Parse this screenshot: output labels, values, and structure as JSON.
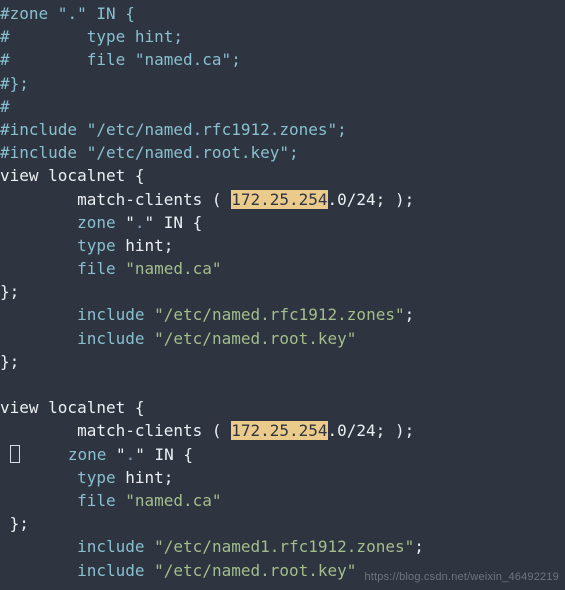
{
  "lines": {
    "l1_a": "#zone \"",
    "l1_b": ".",
    "l1_c": "\" IN {",
    "l2": "#        type hint;",
    "l3": "#        file \"named.ca\";",
    "l4": "#};",
    "l5": "#",
    "l6_a": "#include ",
    "l6_b": "\"/etc/named.rfc1912.zones\"",
    "l6_c": ";",
    "l7_a": "#include ",
    "l7_b": "\"/etc/named.root.key\"",
    "l7_c": ";",
    "l8": "view localnet {",
    "l9_a": "        match-clients ( ",
    "l9_hl": "172.25.254",
    "l9_b": ".0/24; );",
    "l10_a": "        ",
    "l10_b": "zone",
    "l10_c": " \"",
    "l10_d": ".",
    "l10_e": "\" IN {",
    "l11_a": "        ",
    "l11_b": "type",
    "l11_c": " hint",
    "l11_d": ";",
    "l12_a": "        ",
    "l12_b": "file",
    "l12_c": " ",
    "l12_d": "\"named.ca\"",
    "l13": "};",
    "l14_a": "        ",
    "l14_b": "include",
    "l14_c": " ",
    "l14_d": "\"/etc/named.rfc1912.zones\"",
    "l14_e": ";",
    "l15_a": "        ",
    "l15_b": "include",
    "l15_c": " ",
    "l15_d": "\"/etc/named.root.key\"",
    "l16": "};",
    "blank": "",
    "l17": "view localnet {",
    "l18_a": "        match-clients ( ",
    "l18_hl": "172.25.254",
    "l18_b": ".0/24; );",
    "l19_a": "        ",
    "l19_b": "zone",
    "l19_c": " \"",
    "l19_d": ".",
    "l19_e": "\" IN {",
    "l20_a": "        ",
    "l20_b": "type",
    "l20_c": " hint",
    "l20_d": ";",
    "l21_a": "        ",
    "l21_b": "file",
    "l21_c": " ",
    "l21_d": "\"named.ca\"",
    "l22": " };",
    "l23_a": "        ",
    "l23_b": "include",
    "l23_c": " ",
    "l23_d": "\"/etc/named1.rfc1912.zones\"",
    "l23_e": ";",
    "l24_a": "        ",
    "l24_b": "include",
    "l24_c": " ",
    "l24_d": "\"/etc/named.root.key\""
  },
  "watermark": "https://blog.csdn.net/weixin_46492219"
}
